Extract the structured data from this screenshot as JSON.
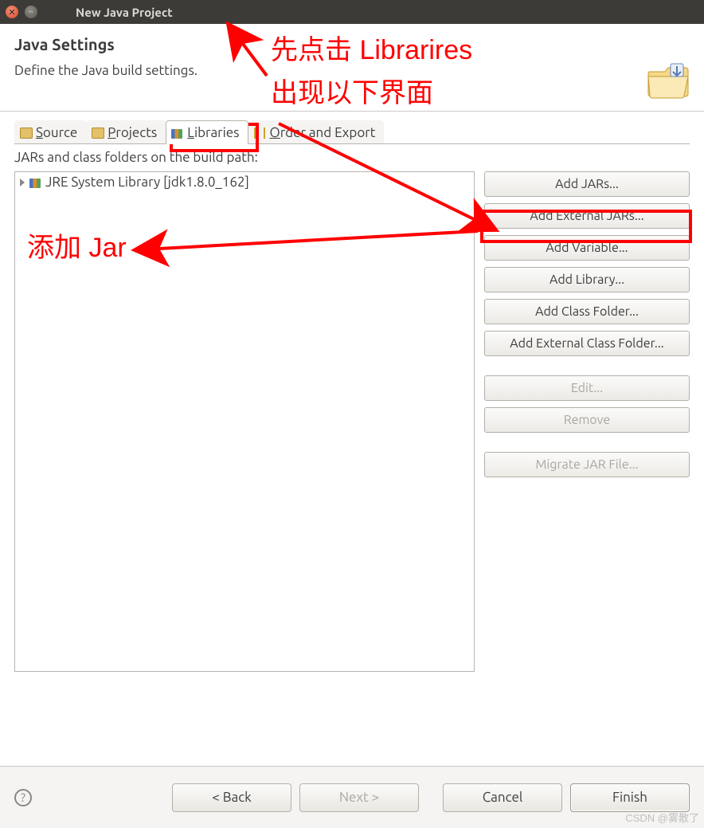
{
  "window": {
    "title": "New Java Project"
  },
  "header": {
    "title": "Java Settings",
    "description": "Define the Java build settings."
  },
  "tabs": {
    "source": {
      "label_pre": "",
      "label_u": "S",
      "label_post": "ource"
    },
    "projects": {
      "label_pre": "",
      "label_u": "P",
      "label_post": "rojects"
    },
    "libraries": {
      "label_pre": "",
      "label_u": "L",
      "label_post": "ibraries"
    },
    "order": {
      "label_pre": "",
      "label_u": "O",
      "label_post": "rder and Export"
    }
  },
  "subdesc": "JARs and class folders on the build path:",
  "tree": {
    "row0": "JRE System Library [jdk1.8.0_162]"
  },
  "side": {
    "add_jars": "Add JARs...",
    "add_ext_jars": "Add External JARs...",
    "add_variable": "Add Variable...",
    "add_library": "Add Library...",
    "add_class_folder": "Add Class Folder...",
    "add_ext_class_folder": "Add External Class Folder...",
    "edit": "Edit...",
    "remove": "Remove",
    "migrate": "Migrate JAR File..."
  },
  "nav": {
    "back": "< Back",
    "next": "Next >",
    "cancel": "Cancel",
    "finish": "Finish"
  },
  "annotations": {
    "line1": "先点击 Librarires",
    "line2": "出现以下界面",
    "line3": "添加 Jar"
  },
  "watermark": "CSDN @雾散了"
}
